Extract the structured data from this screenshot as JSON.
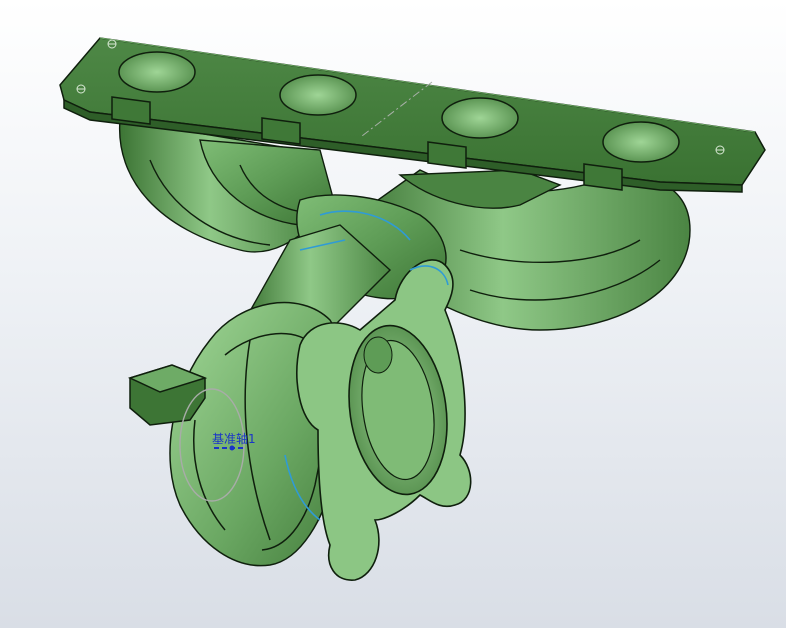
{
  "viewport": {
    "axis_label": "基准轴1"
  },
  "colors": {
    "body": "#5e9c56",
    "body_dark": "#3a7232",
    "body_light": "#8cc684",
    "edge": "#0f1f0d",
    "axis": "#1a35c8",
    "sketch": "#2f9bd6"
  }
}
